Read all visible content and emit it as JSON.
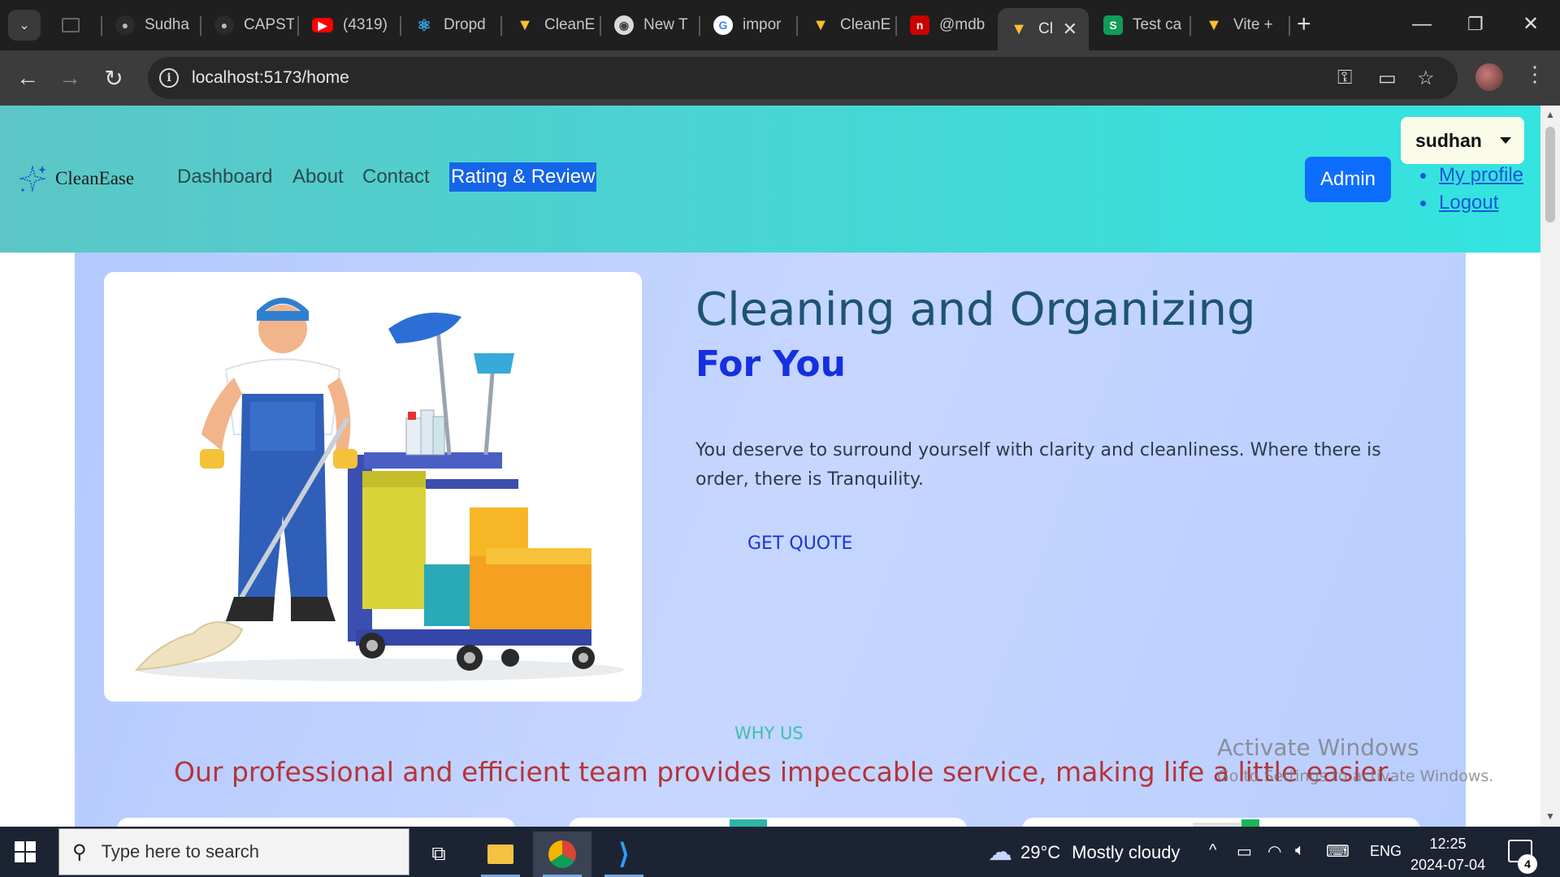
{
  "browser": {
    "tabs": [
      {
        "title": "",
        "favicon": "tab-placeholder-icon"
      },
      {
        "title": "Sudha",
        "favicon": "github-icon"
      },
      {
        "title": "CAPST",
        "favicon": "github-icon"
      },
      {
        "title": "(4319)",
        "favicon": "youtube-icon"
      },
      {
        "title": "Dropd",
        "favicon": "react-icon"
      },
      {
        "title": "CleanE",
        "favicon": "vite-icon"
      },
      {
        "title": "New T",
        "favicon": "chrome-icon"
      },
      {
        "title": "impor",
        "favicon": "google-icon"
      },
      {
        "title": "CleanE",
        "favicon": "vite-icon"
      },
      {
        "title": "@mdb",
        "favicon": "npm-icon"
      },
      {
        "title": "Cl",
        "favicon": "vite-icon"
      },
      {
        "title": "Test ca",
        "favicon": "sheets-icon"
      },
      {
        "title": "Vite +",
        "favicon": "vite-icon"
      }
    ],
    "url": "localhost:5173/home"
  },
  "navbar": {
    "brand": "CleanEase",
    "links": [
      "Dashboard",
      "About",
      "Contact",
      "Rating & Review"
    ],
    "active_link": "Rating & Review",
    "admin_label": "Admin",
    "user_name": "sudhan",
    "user_menu": [
      "My profile",
      "Logout"
    ]
  },
  "hero": {
    "title": "Cleaning and Organizing",
    "subtitle": "For You",
    "description": "You deserve to surround yourself with clarity and cleanliness. Where there is order, there is Tranquility.",
    "cta_label": "GET QUOTE",
    "section_label": "WHY US",
    "tagline": "Our professional and efficient team provides impeccable service, making life a little easier."
  },
  "watermark": {
    "line1": "Activate Windows",
    "line2": "Go to Settings to activate Windows."
  },
  "taskbar": {
    "search_placeholder": "Type here to search",
    "weather_temp": "29°C",
    "weather_text": "Mostly cloudy",
    "language": "ENG",
    "time": "12:25",
    "date": "2024-07-04",
    "notification_count": "4"
  },
  "colors": {
    "navbar_gradient_start": "#5cc6c6",
    "navbar_gradient_end": "#33e4e0",
    "admin_button": "#0d6efd",
    "hero_bg": "#c6d6ff",
    "hero_title": "#1e5376",
    "hero_subtitle": "#1430e0",
    "tagline": "#b5343a",
    "why_us": "#3cc0b0"
  }
}
